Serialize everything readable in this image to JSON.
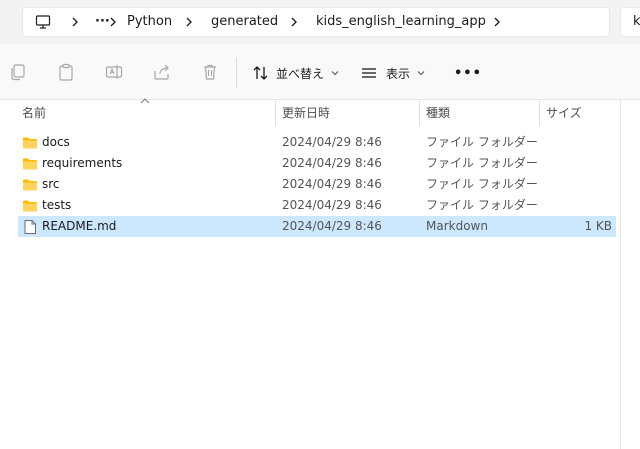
{
  "address_bar": {
    "overflow": "···",
    "crumbs": [
      "Python",
      "generated",
      "kids_english_learning_app"
    ],
    "search_partial": "k"
  },
  "toolbar": {
    "sort_label": "並べ替え",
    "view_label": "表示",
    "more_label": "•••"
  },
  "columns": {
    "name": "名前",
    "date": "更新日時",
    "type": "種類",
    "size": "サイズ"
  },
  "files": [
    {
      "name": "docs",
      "date": "2024/04/29 8:46",
      "type": "ファイル フォルダー",
      "size": "",
      "icon": "folder-icon",
      "selected": false
    },
    {
      "name": "requirements",
      "date": "2024/04/29 8:46",
      "type": "ファイル フォルダー",
      "size": "",
      "icon": "folder-icon",
      "selected": false
    },
    {
      "name": "src",
      "date": "2024/04/29 8:46",
      "type": "ファイル フォルダー",
      "size": "",
      "icon": "folder-icon",
      "selected": false
    },
    {
      "name": "tests",
      "date": "2024/04/29 8:46",
      "type": "ファイル フォルダー",
      "size": "",
      "icon": "folder-icon",
      "selected": false
    },
    {
      "name": "README.md",
      "date": "2024/04/29 8:46",
      "type": "Markdown",
      "size": "1 KB",
      "icon": "file-icon",
      "selected": true
    }
  ],
  "colors": {
    "selection": "#cce8ff",
    "folder": "#ffc83d",
    "toolbar_bg": "#f9f9f9"
  }
}
